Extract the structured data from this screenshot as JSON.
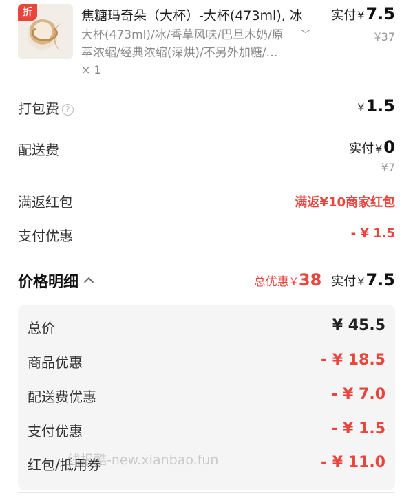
{
  "product": {
    "badge": "折",
    "image_icon": "caramel-macchiato-cup",
    "title": "焦糖玛奇朵（大杯）-大杯(473ml), 冰",
    "spec_line1": "大杯(473ml)/冰/香草风味/巴旦木奶/原",
    "spec_line2": "萃浓缩/经典浓缩(深烘)/不另外加糖/…",
    "quantity": "× 1",
    "paid_label": "实付",
    "currency": "¥",
    "paid_amount": "7.5",
    "original_price": "¥37"
  },
  "fees": {
    "packing_label": "打包费",
    "packing_help": "?",
    "packing_currency": "¥",
    "packing_amount": "1.5",
    "delivery_label": "配送费",
    "delivery_paid_label": "实付",
    "delivery_currency": "¥",
    "delivery_amount": "0",
    "delivery_original": "¥7",
    "rebate_label": "满返红包",
    "rebate_value": "满返¥10商家红包",
    "paydisc_label": "支付优惠",
    "paydisc_value": "- ¥ 1.5"
  },
  "summary": {
    "title": "价格明细",
    "total_discount_label": "总优惠",
    "total_discount_currency": "¥",
    "total_discount_amount": "38",
    "paid_label": "实付",
    "paid_currency": "¥",
    "paid_amount": "7.5"
  },
  "details": [
    {
      "label": "总价",
      "value": "¥ 45.5"
    },
    {
      "label": "商品优惠",
      "value": "- ¥ 18.5"
    },
    {
      "label": "配送费优惠",
      "value": "- ¥ 7.0"
    },
    {
      "label": "支付优惠",
      "value": "- ¥ 1.5"
    },
    {
      "label": "红包/抵用券",
      "value": "- ¥ 11.0"
    }
  ],
  "watermark": "线报酷-new.xianbao.fun",
  "colors": {
    "accent_red": "#e8453c",
    "detail_bg": "#f5f5f5"
  }
}
